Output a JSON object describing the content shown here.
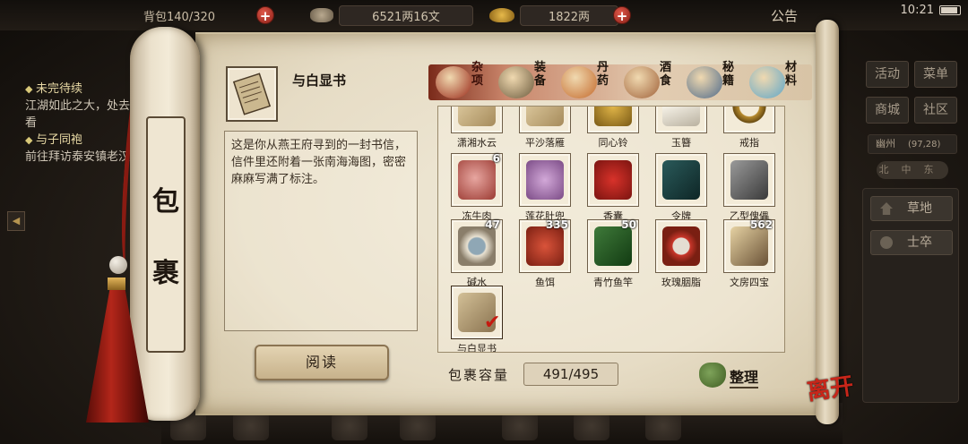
{
  "topbar": {
    "capacity_text": "背包140/320",
    "coins_text": "6521两16文",
    "ingots_text": "1822两",
    "notice_label": "公告",
    "time": "10:21"
  },
  "quests": {
    "section1_title": "未完待续",
    "section1_desc": "江湖如此之大，处去看看",
    "section2_title": "与子同袍",
    "section2_desc": "前往拜访泰安镇老汉"
  },
  "scroll": {
    "title_chars": [
      "包",
      "裹"
    ]
  },
  "selected_item": {
    "name": "与白显书",
    "description": "这是你从燕王府寻到的一封书信，信件里还附着一张南海海图，密密麻麻写满了标注。",
    "read_label": "阅读"
  },
  "tabs": [
    {
      "label": "杂项",
      "active": true,
      "icon": "jar-icon"
    },
    {
      "label": "装备",
      "active": false,
      "icon": "weapon-icon"
    },
    {
      "label": "丹药",
      "active": false,
      "icon": "pill-icon"
    },
    {
      "label": "酒食",
      "active": false,
      "icon": "wine-icon"
    },
    {
      "label": "秘籍",
      "active": false,
      "icon": "book-icon"
    },
    {
      "label": "材料",
      "active": false,
      "icon": "crystal-icon"
    }
  ],
  "items": [
    {
      "name": "潇湘水云",
      "count": "",
      "icon": "scroll-icon"
    },
    {
      "name": "平沙落雁",
      "count": "",
      "icon": "scroll-icon"
    },
    {
      "name": "同心铃",
      "count": "",
      "icon": "bell-icon"
    },
    {
      "name": "玉簪",
      "count": "",
      "icon": "hairpin-icon"
    },
    {
      "name": "戒指",
      "count": "",
      "icon": "ring-icon"
    },
    {
      "name": "冻牛肉",
      "count": "6",
      "icon": "meat-icon"
    },
    {
      "name": "莲花肚兜",
      "count": "",
      "icon": "bib-icon"
    },
    {
      "name": "香囊",
      "count": "",
      "icon": "sachet-icon"
    },
    {
      "name": "令牌",
      "count": "",
      "icon": "token-icon"
    },
    {
      "name": "乙型傀儡",
      "count": "",
      "icon": "puppet-icon"
    },
    {
      "name": "碱水",
      "count": "47",
      "icon": "bowl-icon"
    },
    {
      "name": "鱼饵",
      "count": "335",
      "icon": "worm-icon"
    },
    {
      "name": "青竹鱼竿",
      "count": "50",
      "icon": "rod-icon"
    },
    {
      "name": "玫瑰胭脂",
      "count": "",
      "icon": "rouge-icon"
    },
    {
      "name": "文房四宝",
      "count": "562",
      "icon": "stationery-icon"
    },
    {
      "name": "与白显书",
      "count": "",
      "icon": "letter-icon",
      "selected": true
    }
  ],
  "footer": {
    "capacity_label": "包裹容量",
    "capacity_value": "491/495",
    "tidy_label": "整理"
  },
  "right_menu": {
    "buttons": [
      "活动",
      "菜单",
      "商城",
      "社区"
    ],
    "location": "幽州",
    "coords": "(97,28)",
    "list": [
      "草地",
      "士卒"
    ]
  },
  "brand": "离开",
  "colors": {
    "accent_red": "#c51a10",
    "paper": "#e6dcc5",
    "ink": "#2b231a"
  }
}
